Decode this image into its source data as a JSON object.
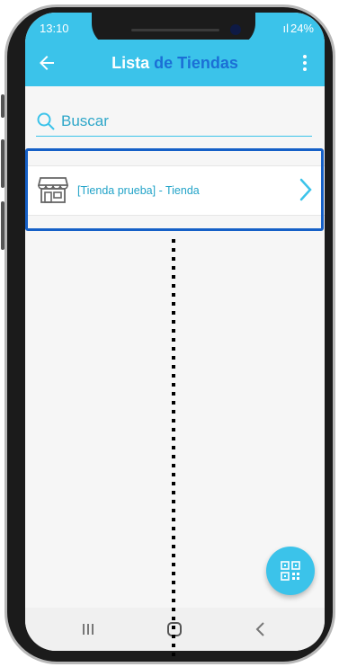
{
  "status_bar": {
    "time": "13:10",
    "signal": "ıl",
    "battery": "24%"
  },
  "app_bar": {
    "title_part1": "Lista",
    "title_part2": "de Tiendas",
    "back_icon": "arrow-back-icon",
    "menu_icon": "more-vert-icon"
  },
  "search": {
    "placeholder": "Buscar",
    "value": ""
  },
  "stores": [
    {
      "label": "[Tienda prueba] - Tienda",
      "icon": "store-icon"
    }
  ],
  "fab": {
    "icon": "qr-code-icon"
  },
  "nav": {
    "recents_icon": "recents-icon",
    "home_icon": "home-icon",
    "back_icon": "back-icon"
  },
  "colors": {
    "primary": "#3bc3ea",
    "title_accent": "#1b6fd6",
    "item_text": "#22a3c8",
    "highlight_border": "#1560c7"
  }
}
